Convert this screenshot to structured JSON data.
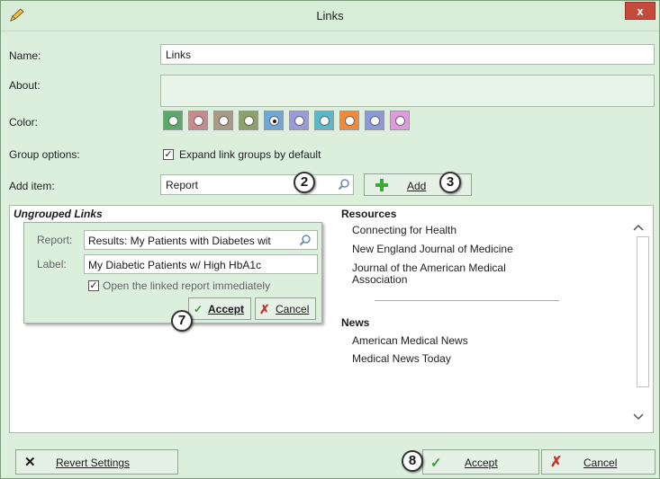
{
  "window": {
    "title": "Links",
    "close_label": "x"
  },
  "form": {
    "name_label": "Name:",
    "name_value": "Links",
    "about_label": "About:",
    "about_value": "",
    "color_label": "Color:",
    "colors": [
      "#5aa86a",
      "#c98a8e",
      "#a89a84",
      "#8aa26a",
      "#6fa8d8",
      "#9a9ad8",
      "#5ab8c8",
      "#f08a3a",
      "#8a9ad8",
      "#e09ae0"
    ],
    "selected_color_index": 4,
    "group_options_label": "Group options:",
    "expand_groups_checked": true,
    "expand_groups_label": "Expand link groups by default",
    "add_item_label": "Add item:",
    "add_item_value": "Report",
    "add_button_label": "Add"
  },
  "badges": {
    "b2": "2",
    "b3": "3",
    "b7": "7",
    "b8": "8"
  },
  "links_panel": {
    "ungrouped_heading": "Ungrouped Links",
    "editor": {
      "report_label": "Report:",
      "report_value": "Results: My Patients with Diabetes wit",
      "label_label": "Label:",
      "label_value": "My Diabetic Patients w/ High HbA1c",
      "open_checked": true,
      "open_label": "Open the linked report immediately",
      "accept_label": "Accept",
      "cancel_label": "Cancel"
    },
    "resources_heading": "Resources",
    "resources": [
      "Connecting for Health",
      "New England Journal of Medicine",
      "Journal of the American Medical Association"
    ],
    "news_heading": "News",
    "news": [
      "American Medical News",
      "Medical News Today"
    ]
  },
  "footer": {
    "revert_label": "Revert Settings",
    "accept_label": "Accept",
    "cancel_label": "Cancel"
  }
}
